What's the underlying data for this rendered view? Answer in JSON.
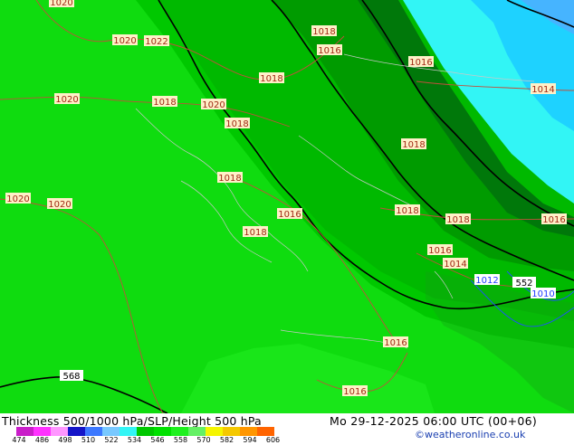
{
  "map": {
    "thickness_isolines": [
      "568",
      "552"
    ],
    "slp_labels": [
      {
        "text": "1020",
        "pos": [
          68,
          2
        ]
      },
      {
        "text": "1020",
        "pos": [
          138,
          44
        ]
      },
      {
        "text": "1022",
        "pos": [
          173,
          45
        ]
      },
      {
        "text": "1018",
        "pos": [
          358,
          34
        ]
      },
      {
        "text": "1016",
        "pos": [
          364,
          55
        ]
      },
      {
        "text": "1016",
        "pos": [
          465,
          68
        ]
      },
      {
        "text": "1014",
        "pos": [
          600,
          98
        ]
      },
      {
        "text": "1018",
        "pos": [
          300,
          86
        ]
      },
      {
        "text": "1020",
        "pos": [
          74,
          109
        ]
      },
      {
        "text": "1018",
        "pos": [
          182,
          112
        ]
      },
      {
        "text": "1020",
        "pos": [
          236,
          115
        ]
      },
      {
        "text": "1018",
        "pos": [
          262,
          136
        ]
      },
      {
        "text": "1018",
        "pos": [
          457,
          159
        ]
      },
      {
        "text": "1018",
        "pos": [
          254,
          196
        ]
      },
      {
        "text": "1020",
        "pos": [
          20,
          219
        ]
      },
      {
        "text": "1020",
        "pos": [
          66,
          225
        ]
      },
      {
        "text": "1016",
        "pos": [
          320,
          236
        ]
      },
      {
        "text": "1018",
        "pos": [
          282,
          256
        ]
      },
      {
        "text": "1018",
        "pos": [
          450,
          232
        ]
      },
      {
        "text": "1018",
        "pos": [
          506,
          242
        ]
      },
      {
        "text": "1016",
        "pos": [
          612,
          242
        ]
      },
      {
        "text": "1016",
        "pos": [
          486,
          276
        ]
      },
      {
        "text": "1014",
        "pos": [
          503,
          291
        ]
      },
      {
        "text": "1016",
        "pos": [
          437,
          378
        ]
      },
      {
        "text": "1016",
        "pos": [
          392,
          432
        ]
      }
    ],
    "blue_labels": [
      {
        "text": "1012",
        "pos": [
          538,
          309
        ]
      },
      {
        "text": "1010",
        "pos": [
          600,
          324
        ]
      }
    ]
  },
  "footer": {
    "title": "Thickness 500/1000 hPa/SLP/Height 500 hPa",
    "datetime": "Mo 29-12-2025 06:00 UTC (00+06)",
    "credit": "©weatheronline.co.uk",
    "legend": {
      "colors": [
        "#c91ec9",
        "#ff32ff",
        "#ff96ff",
        "#1414c8",
        "#3c78ff",
        "#78c8ff",
        "#32f5f5",
        "#00c800",
        "#00e100",
        "#1ef01e",
        "#64f064",
        "#f5f500",
        "#f5c800",
        "#ff9600",
        "#ff6400"
      ],
      "ticks": [
        "474",
        "486",
        "498",
        "510",
        "522",
        "534",
        "546",
        "558",
        "570",
        "582",
        "594",
        "606"
      ]
    }
  }
}
